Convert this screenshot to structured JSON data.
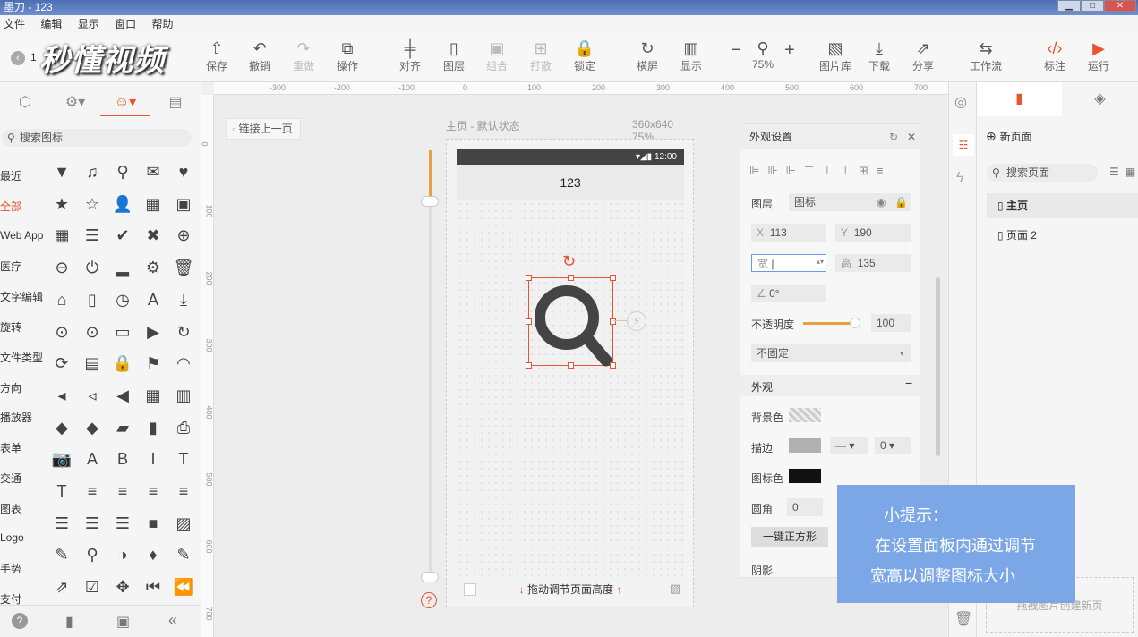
{
  "window": {
    "title": "墨刀 - 123"
  },
  "menu": [
    "文件",
    "编辑",
    "显示",
    "窗口",
    "帮助"
  ],
  "logo_text": "秒懂视频",
  "toolbar": {
    "back_text": "1",
    "items": [
      {
        "label": "保存",
        "icon": "save-icon"
      },
      {
        "label": "撤销",
        "icon": "undo-icon"
      },
      {
        "label": "重做",
        "icon": "redo-icon"
      },
      {
        "label": "操作",
        "icon": "copy-icon"
      },
      {
        "label": "对齐",
        "icon": "align-icon"
      },
      {
        "label": "图层",
        "icon": "layers-icon"
      },
      {
        "label": "组合",
        "icon": "group-icon"
      },
      {
        "label": "打散",
        "icon": "ungroup-icon"
      },
      {
        "label": "锁定",
        "icon": "lock-icon"
      },
      {
        "label": "横屏",
        "icon": "rotate-icon"
      },
      {
        "label": "显示",
        "icon": "display-icon"
      },
      {
        "label": "75%",
        "icon": "zoom-icon"
      },
      {
        "label": "图片库",
        "icon": "image-library-icon"
      },
      {
        "label": "下载",
        "icon": "download-icon"
      },
      {
        "label": "分享",
        "icon": "share-icon"
      },
      {
        "label": "工作流",
        "icon": "workflow-icon"
      },
      {
        "label": "标注",
        "icon": "code-icon"
      },
      {
        "label": "运行",
        "icon": "play-icon"
      }
    ]
  },
  "left": {
    "search_placeholder": "搜索图标",
    "categories": [
      "最近",
      "全部",
      "Web App",
      "医疗",
      "文字编辑",
      "旋转",
      "文件类型",
      "方向",
      "播放器",
      "表单",
      "交通",
      "图表",
      "Logo",
      "手势",
      "支付"
    ],
    "icon_rows": [
      [
        "▼",
        "♫",
        "⚲",
        "✉",
        "♥"
      ],
      [
        "★",
        "☆",
        "👤",
        "▦",
        "▣"
      ],
      [
        "▦",
        "☰",
        "✔",
        "✖",
        "⊕"
      ],
      [
        "⊖",
        "⏻",
        "▂",
        "⚙",
        "🗑"
      ],
      [
        "⌂",
        "▯",
        "◷",
        "A",
        "⤓"
      ],
      [
        "⊙",
        "⊙",
        "▭",
        "▶",
        "↻"
      ],
      [
        "⟳",
        "▤",
        "🔒",
        "⚑",
        "◠"
      ],
      [
        "◂",
        "◃",
        "◀",
        "▦",
        "▥"
      ],
      [
        "◆",
        "◆",
        "▰",
        "▮",
        "⎙"
      ],
      [
        "📷",
        "A",
        "B",
        "I",
        "T"
      ],
      [
        "T",
        "≡",
        "≡",
        "≡",
        "≡"
      ],
      [
        "☰",
        "☰",
        "☰",
        "■",
        "▨"
      ],
      [
        "✎",
        "⚲",
        "◑",
        "♦",
        "✎"
      ],
      [
        "⇗",
        "☑",
        "✥",
        "⏮",
        "⏪"
      ]
    ]
  },
  "ruler_ticks": [
    "-300",
    "-200",
    "-100",
    "0",
    "100",
    "200",
    "300",
    "400",
    "500",
    "600",
    "700"
  ],
  "vruler_ticks": [
    "0",
    "100",
    "200",
    "300",
    "400",
    "500",
    "600",
    "700"
  ],
  "canvas": {
    "link_prev": "链接上一页",
    "page_header": "主页 - 默认状态",
    "page_size": "360x640 75%",
    "status_time": "12:00",
    "nav_title": "123",
    "bottom_hint": "拖动调节页面高度"
  },
  "props": {
    "title": "外观设置",
    "layer_label": "图层",
    "layer_value": "图标",
    "x_label": "X",
    "x_value": "113",
    "y_label": "Y",
    "y_value": "190",
    "w_label": "宽",
    "w_value": "",
    "h_label": "高",
    "h_value": "135",
    "angle": "0°",
    "opacity_label": "不透明度",
    "opacity_value": "100",
    "opacity_level": 0.9,
    "fixed_value": "不固定",
    "appearance_label": "外观",
    "bg_label": "背景色",
    "border_label": "描边",
    "border_width": "0",
    "icon_color_label": "图标色",
    "icon_color": "#111111",
    "radius_label": "圆角",
    "radius_value": "0",
    "square_button": "一键正方形",
    "shadow_label": "阴影"
  },
  "pages": {
    "new_page": "新页面",
    "search_placeholder": "搜索页面",
    "items": [
      "主页",
      "页面 2"
    ],
    "drop_hint": "拖拽图片创建新页"
  },
  "tip": {
    "title": "小提示：",
    "line1": "在设置面板内通过调节",
    "line2": "宽高以调整图标大小"
  },
  "colors": {
    "accent": "#e8542f",
    "tip_bg": "#7ba7e6",
    "slider": "#e8a040"
  }
}
